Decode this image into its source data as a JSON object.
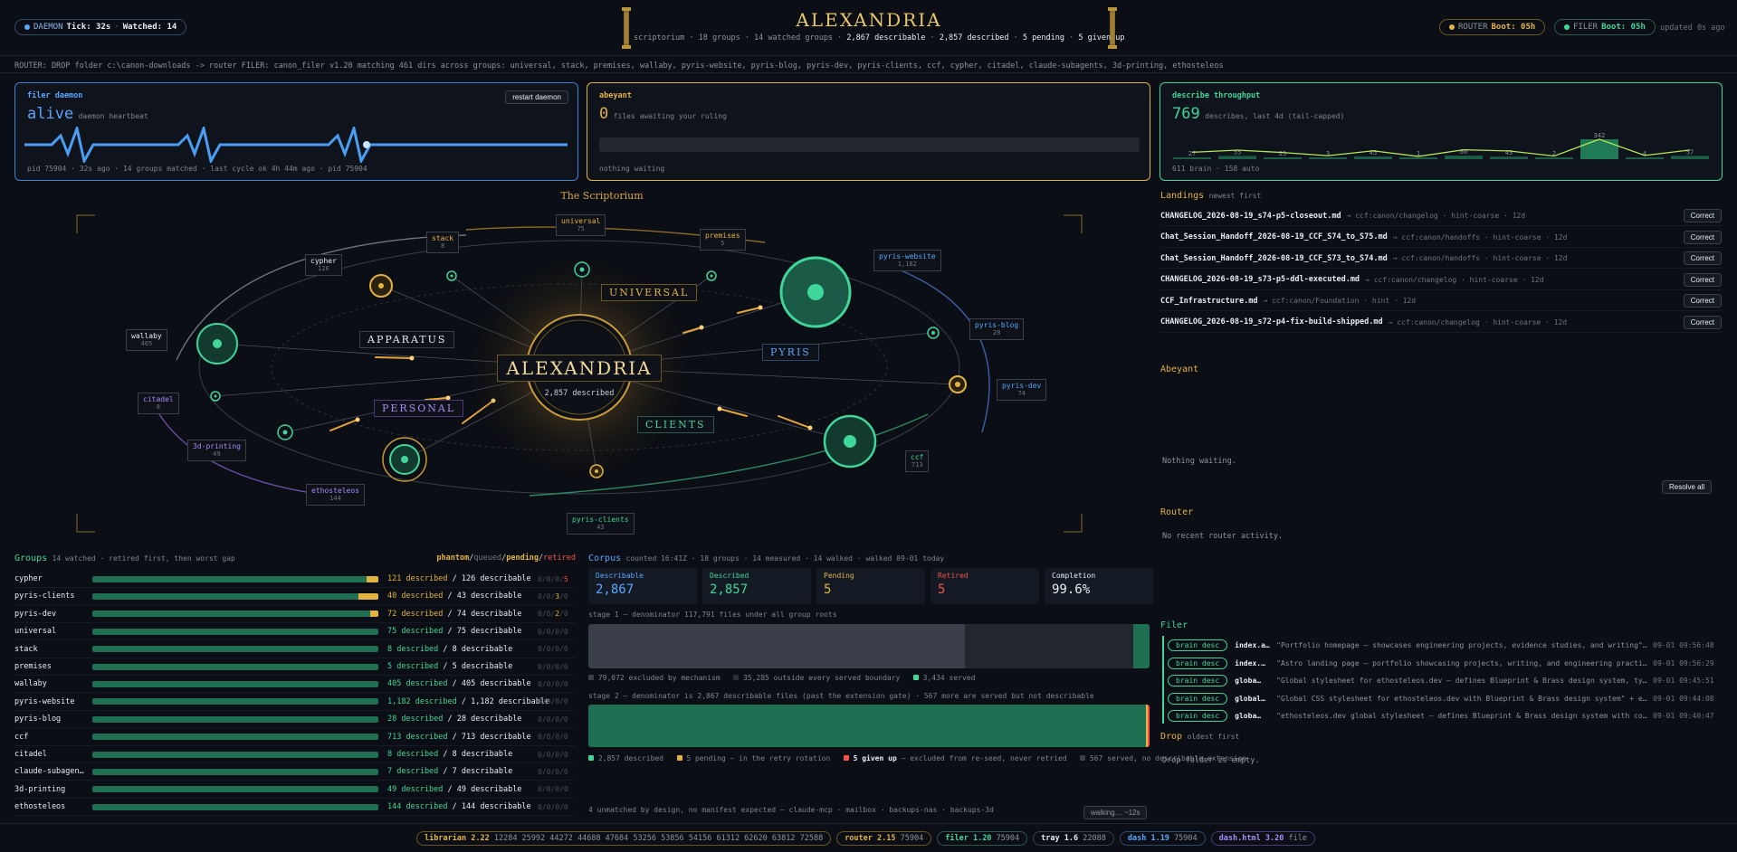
{
  "header": {
    "daemon_pill": "DAEMON",
    "tick": "Tick: 32s",
    "watched": "Watched: 14",
    "title": "ALEXANDRIA",
    "subtitle_prefix": "scriptorium · 18 groups · 14 watched groups ·",
    "subtitle_describable": "2,867 describable",
    "subtitle_described": "2,857 described",
    "subtitle_pending": "5 pending",
    "subtitle_givenup": "5 given up",
    "router_pill": "ROUTER",
    "router_boot": "Boot: 05h",
    "filer_pill": "FILER",
    "filer_boot": "Boot: 05h",
    "updated": "updated 0s ago"
  },
  "router_line": "ROUTER: DROP folder c:\\canon-downloads -> router   FILER: canon_filer v1.20 matching 461 dirs across groups: universal, stack, premises, wallaby, pyris-website, pyris-blog, pyris-dev, pyris-clients, ccf, cypher, citadel, claude-subagents, 3d-printing, ethosteleos",
  "filer_daemon": {
    "title": "filer daemon",
    "restart": "restart daemon",
    "status": "alive",
    "status_sub": "daemon heartbeat",
    "footer": "pid 75904 · 32s ago · 14 groups matched · last cycle ok 4h 44m ago · pid 75904"
  },
  "abeyant_card": {
    "title": "abeyant",
    "count": "0",
    "count_sub": "files awaiting your ruling",
    "footer": "nothing waiting"
  },
  "throughput": {
    "title": "describe throughput",
    "count": "769",
    "count_sub": "describes, last 4d (tail-capped)",
    "footer": "611 brain · 158 auto",
    "bars": [
      27,
      55,
      25,
      3,
      45,
      1,
      60,
      43,
      2,
      342,
      4,
      57
    ],
    "bar_labels": [
      "27",
      "55",
      "25",
      "3",
      "45",
      "1",
      "60",
      "43",
      "2",
      "342",
      "4",
      "57"
    ]
  },
  "scriptorium": {
    "title": "The Scriptorium",
    "center_title": "ALEXANDRIA",
    "center_sub": "2,857 described",
    "bands": {
      "universal": "UNIVERSAL",
      "apparatus": "APPARATUS",
      "pyris": "PYRIS",
      "personal": "PERSONAL",
      "clients": "CLIENTS"
    },
    "nodes": [
      {
        "name": "universal",
        "n": "75"
      },
      {
        "name": "stack",
        "n": "8"
      },
      {
        "name": "premises",
        "n": "5"
      },
      {
        "name": "cypher",
        "n": "126"
      },
      {
        "name": "wallaby",
        "n": "405"
      },
      {
        "name": "citadel",
        "n": "8"
      },
      {
        "name": "3d-printing",
        "n": "49"
      },
      {
        "name": "ethosteleos",
        "n": "144"
      },
      {
        "name": "pyris-clients",
        "n": "43"
      },
      {
        "name": "ccf",
        "n": "713"
      },
      {
        "name": "pyris-dev",
        "n": "74"
      },
      {
        "name": "pyris-blog",
        "n": "28"
      },
      {
        "name": "pyris-website",
        "n": "1,182"
      }
    ]
  },
  "groups": {
    "title": "Groups",
    "sub": "14 watched · retired first, then worst gap",
    "legend": {
      "phantom": "phantom",
      "queued": "queued",
      "pending": "pending",
      "retired": "retired"
    },
    "rows": [
      {
        "name": "cypher",
        "described": "121 described",
        "total": "/ 126 describable",
        "frac": 0.96,
        "pend": 0.04,
        "c1": "0/0/0/",
        "c2": "5",
        "color": "gold"
      },
      {
        "name": "pyris-clients",
        "described": "40 described",
        "total": "/ 43 describable",
        "frac": 0.93,
        "pend": 0.07,
        "c1": "0/0/",
        "c2": "3",
        "c3": "/0",
        "color": "gold"
      },
      {
        "name": "pyris-dev",
        "described": "72 described",
        "total": "/ 74 describable",
        "frac": 0.97,
        "pend": 0.03,
        "c1": "0/0/",
        "c2": "2",
        "c3": "/0",
        "color": "gold"
      },
      {
        "name": "universal",
        "described": "75 described",
        "total": "/ 75 describable",
        "frac": 1,
        "pend": 0,
        "c1": "0/0/0/0",
        "color": "green"
      },
      {
        "name": "stack",
        "described": "8 described",
        "total": "/ 8 describable",
        "frac": 1,
        "pend": 0,
        "c1": "0/0/0/0",
        "color": "green"
      },
      {
        "name": "premises",
        "described": "5 described",
        "total": "/ 5 describable",
        "frac": 1,
        "pend": 0,
        "c1": "0/0/0/0",
        "color": "green"
      },
      {
        "name": "wallaby",
        "described": "405 described",
        "total": "/ 405 describable",
        "frac": 1,
        "pend": 0,
        "c1": "0/0/0/0",
        "color": "green"
      },
      {
        "name": "pyris-website",
        "described": "1,182 described",
        "total": "/ 1,182 describable",
        "frac": 1,
        "pend": 0,
        "c1": "0/0/0/0",
        "color": "green"
      },
      {
        "name": "pyris-blog",
        "described": "28 described",
        "total": "/ 28 describable",
        "frac": 1,
        "pend": 0,
        "c1": "0/0/0/0",
        "color": "green"
      },
      {
        "name": "ccf",
        "described": "713 described",
        "total": "/ 713 describable",
        "frac": 1,
        "pend": 0,
        "c1": "0/0/0/0",
        "color": "green"
      },
      {
        "name": "citadel",
        "described": "8 described",
        "total": "/ 8 describable",
        "frac": 1,
        "pend": 0,
        "c1": "0/0/0/0",
        "color": "green"
      },
      {
        "name": "claude-subagen…",
        "described": "7 described",
        "total": "/ 7 describable",
        "frac": 1,
        "pend": 0,
        "c1": "0/0/0/0",
        "color": "green"
      },
      {
        "name": "3d-printing",
        "described": "49 described",
        "total": "/ 49 describable",
        "frac": 1,
        "pend": 0,
        "c1": "0/0/0/0",
        "color": "green"
      },
      {
        "name": "ethosteleos",
        "described": "144 described",
        "total": "/ 144 describable",
        "frac": 1,
        "pend": 0,
        "c1": "0/0/0/0",
        "color": "green"
      }
    ]
  },
  "corpus": {
    "title": "Corpus",
    "sub": "counted 16:41Z · 18 groups · 14 measured · 14 walked · walked 09-01 today",
    "stats": [
      {
        "t": "Describable",
        "v": "2,867",
        "c": "blue"
      },
      {
        "t": "Described",
        "v": "2,857",
        "c": "green"
      },
      {
        "t": "Pending",
        "v": "5",
        "c": "gold"
      },
      {
        "t": "Retired",
        "v": "5",
        "c": "red"
      },
      {
        "t": "Completion",
        "v": "99.6%",
        "c": "white"
      }
    ],
    "stage1": "stage 1 — denominator 117,791 files under all group roots",
    "stage1_legend": [
      "79,072 excluded by mechanism",
      "35,285 outside every served boundary",
      "3,434 served"
    ],
    "stage1_values": [
      79072,
      35285,
      3434
    ],
    "stage2": "stage 2 — denominator is 2,867 describable files (past the extension gate) · 567 more are served but not describable",
    "stage2_legend": {
      "a": "2,857 described",
      "b": "5 pending — in the retry rotation",
      "c1": "5 given up",
      "c2": " — excluded from re-seed, never retried",
      "d": "567 served, no describable extension"
    },
    "stage2_values": [
      2857,
      5,
      5
    ],
    "unmatched": "4 unmatched by design, no manifest expected — claude-mcp · mailbox · backups-nas · backups-3d",
    "walking": "walking… ~12s"
  },
  "landings": {
    "title": "Landings",
    "sub": "newest first",
    "items": [
      {
        "f": "CHANGELOG_2026-08-19_s74-p5-closeout.md",
        "m": "→ ccf:canon/changelog · hint-coarse · 12d"
      },
      {
        "f": "Chat_Session_Handoff_2026-08-19_CCF_S74_to_S75.md",
        "m": "→ ccf:canon/handoffs · hint-coarse · 12d"
      },
      {
        "f": "Chat_Session_Handoff_2026-08-19_CCF_S73_to_S74.md",
        "m": "→ ccf:canon/handoffs · hint-coarse · 12d"
      },
      {
        "f": "CHANGELOG_2026-08-19_s73-p5-ddl-executed.md",
        "m": "→ ccf:canon/changelog · hint-coarse · 12d"
      },
      {
        "f": "CCF_Infrastructure.md",
        "m": "→ ccf:canon/Foundation · hint · 12d"
      },
      {
        "f": "CHANGELOG_2026-08-19_s72-p4-fix-build-shipped.md",
        "m": "→ ccf:canon/changelog · hint-coarse · 12d"
      }
    ],
    "correct": "Correct"
  },
  "abeyant": {
    "title": "Abeyant",
    "empty": "Nothing waiting.",
    "resolve": "Resolve all"
  },
  "router": {
    "title": "Router",
    "empty": "No recent router activity."
  },
  "filer": {
    "title": "Filer",
    "tag": "brain desc",
    "items": [
      {
        "f": "index.a…",
        "d": "\"Portfolio homepage — showcases engineering projects, evidence studies, and writing\" + ethos…",
        "t": "09-01 09:56:48"
      },
      {
        "f": "index.…",
        "d": "\"Astro landing page — portfolio showcasing projects, writing, and engineering practice areas…",
        "t": "09-01 09:56:29"
      },
      {
        "f": "globa…",
        "d": "\"Global stylesheet for ethosteleos.dev — defines Blueprint & Brass design system, typography, …",
        "t": "09-01 09:45:51"
      },
      {
        "f": "global…",
        "d": "\"Global CSS stylesheet for ethosteleos.dev with Blueprint & Brass design system\" + ethostele…",
        "t": "09-01 09:44:08"
      },
      {
        "f": "globa…",
        "d": "\"ethosteleos.dev global stylesheet — defines Blueprint & Brass design system with colors, typo…",
        "t": "09-01 09:40:47"
      }
    ]
  },
  "drop": {
    "title": "Drop",
    "sub": "oldest first",
    "empty": "Drop folder is empty."
  },
  "footer": [
    {
      "name": "librarian",
      "ver": "2.22",
      "pids": "12284 25992 44272 44688 47684 53256 53856 54156 61312 62620 63812 72588",
      "c": "#e3b341",
      "b": "#6b5520"
    },
    {
      "name": "router",
      "ver": "2.15",
      "pids": "75904",
      "c": "#e3b341",
      "b": "#6b5520"
    },
    {
      "name": "filer",
      "ver": "1.20",
      "pids": "75904",
      "c": "#3fd69a",
      "b": "#2c5a48"
    },
    {
      "name": "tray",
      "ver": "1.6",
      "pids": "22088",
      "c": "#e6edf3",
      "b": "#3a3f4a"
    },
    {
      "name": "dash",
      "ver": "1.19",
      "pids": "75904",
      "c": "#58a6ff",
      "b": "#2d4a6b"
    },
    {
      "name": "dash.html",
      "ver": "3.20",
      "pids": "file",
      "c": "#a78bfa",
      "b": "#4b3a7a"
    }
  ]
}
